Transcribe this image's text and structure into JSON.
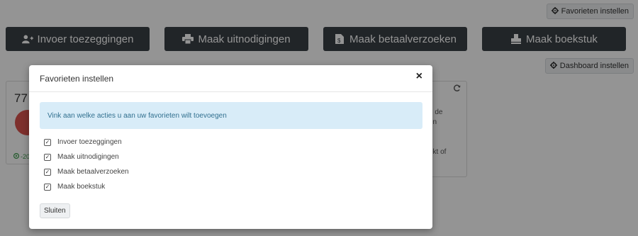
{
  "toolbar": {
    "favorites_label": "Favorieten instellen",
    "dashboard_label": "Dashboard instellen"
  },
  "actions": [
    {
      "label": "Invoer toezeggingen",
      "icon": "user-plus-icon"
    },
    {
      "label": "Maak uitnodigingen",
      "icon": "printer-icon"
    },
    {
      "label": "Maak betaalverzoeken",
      "icon": "document-icon"
    },
    {
      "label": "Maak boekstuk",
      "icon": "stamp-icon"
    }
  ],
  "cards": {
    "left": {
      "number": "77",
      "footer": "-20"
    },
    "right": {
      "lines": [
        "n de",
        "en",
        "-",
        "ekt of",
        "-"
      ]
    }
  },
  "modal": {
    "title": "Favorieten instellen",
    "close_label": "×",
    "info": "Vink aan welke acties u aan uw favorieten wilt toevoegen",
    "options": [
      {
        "label": "Invoer toezeggingen",
        "checked": true
      },
      {
        "label": "Maak uitnodigingen",
        "checked": true
      },
      {
        "label": "Maak betaalverzoeken",
        "checked": true
      },
      {
        "label": "Maak boekstuk",
        "checked": true
      }
    ],
    "close_button": "Sluiten"
  },
  "colors": {
    "action_bg": "#3a4046",
    "info_bg": "#d8ecf8",
    "info_text": "#31708f",
    "badge_red": "#d9534f"
  }
}
